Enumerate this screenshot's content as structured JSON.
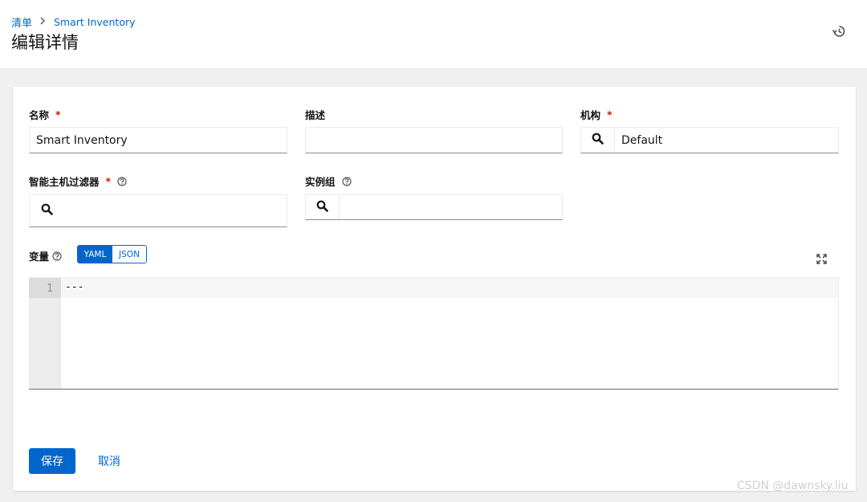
{
  "breadcrumb": {
    "root": "清单",
    "current": "Smart Inventory"
  },
  "page_title": "编辑详情",
  "form": {
    "name": {
      "label": "名称",
      "required": "*",
      "value": "Smart Inventory"
    },
    "description": {
      "label": "描述",
      "value": ""
    },
    "organization": {
      "label": "机构",
      "required": "*",
      "value": "Default"
    },
    "host_filter": {
      "label": "智能主机过滤器",
      "required": "*",
      "value": ""
    },
    "instance_groups": {
      "label": "实例组",
      "value": ""
    },
    "variables": {
      "label": "变量",
      "modes": [
        "YAML",
        "JSON"
      ],
      "selected_mode": "YAML",
      "line_number": "1",
      "content": "---"
    }
  },
  "actions": {
    "save": "保存",
    "cancel": "取消"
  },
  "watermark": "CSDN @dawnsky.liu",
  "colors": {
    "primary": "#0066cc",
    "required": "#c9190b",
    "background": "#f0f0f0"
  },
  "icons": [
    "history-icon",
    "search-icon",
    "help-icon",
    "expand-icon"
  ]
}
